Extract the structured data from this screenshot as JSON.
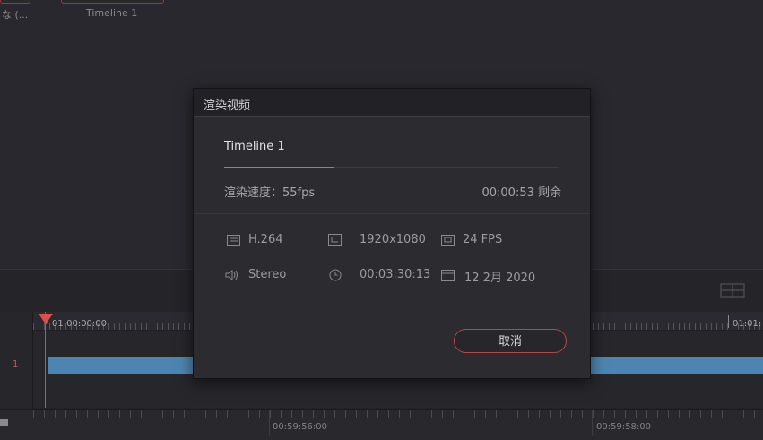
{
  "media_pool": {
    "clip1_label": "な (...",
    "clip2_label": "Timeline 1"
  },
  "timeline": {
    "track_number": "1",
    "timecode_start": "01:00:00:00",
    "timecode_right": "01:01:",
    "mini_timecode_1": "00:59:56:00",
    "mini_timecode_2": "00:59:58:00"
  },
  "dialog": {
    "title": "渲染视频",
    "job_name": "Timeline 1",
    "progress_fraction": 0.33,
    "speed_text": "渲染速度：55fps",
    "remaining_text": "00:00:53 剩余",
    "specs": {
      "codec": "H.264",
      "resolution": "1920x1080",
      "fps": "24 FPS",
      "audio": "Stereo",
      "duration": "00:03:30:13",
      "date": "12 2月 2020"
    },
    "cancel_label": "取消"
  },
  "colors": {
    "accent": "#6aa33a",
    "cancel_border": "#b8474a",
    "clip": "#4c86b0",
    "playhead": "#e04d4d"
  }
}
